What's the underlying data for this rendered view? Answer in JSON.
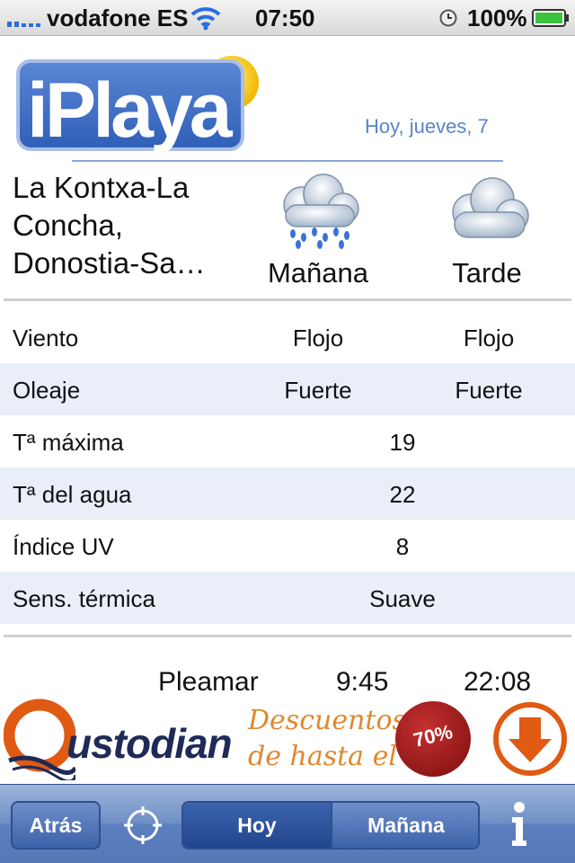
{
  "status_bar": {
    "carrier": "vodafone ES",
    "time": "07:50",
    "battery": "100%"
  },
  "header": {
    "logo_text": "iPlaya",
    "date": "Hoy, jueves, 7"
  },
  "beach": {
    "name_lines": [
      "La Kontxa-La",
      "Concha,",
      "Donostia-Sa…"
    ]
  },
  "forecast": {
    "morning": {
      "label": "Mañana",
      "icon": "rain-cloud-icon"
    },
    "afternoon": {
      "label": "Tarde",
      "icon": "cloud-icon"
    }
  },
  "rows": [
    {
      "label": "Viento",
      "morning": "Flojo",
      "afternoon": "Flojo"
    },
    {
      "label": "Oleaje",
      "morning": "Fuerte",
      "afternoon": "Fuerte"
    },
    {
      "label": "Tª máxima",
      "value": "19"
    },
    {
      "label": "Tª del agua",
      "value": "22"
    },
    {
      "label": "Índice UV",
      "value": "8"
    },
    {
      "label": "Sens. térmica",
      "value": "Suave"
    }
  ],
  "tides": {
    "label": "Pleamar",
    "first": "9:45",
    "second": "22:08"
  },
  "ad": {
    "brand": "ustodian",
    "line1": "Descuentos",
    "line2": "de hasta el",
    "badge": "70%"
  },
  "toolbar": {
    "back": "Atrás",
    "tab_today": "Hoy",
    "tab_tomorrow": "Mañana"
  },
  "colors": {
    "accent": "#5a84c8",
    "row_alt": "#e9eef8",
    "toolbar": "#6f8fc6",
    "ad_orange": "#e0882e",
    "ad_navy": "#1e2a57"
  }
}
